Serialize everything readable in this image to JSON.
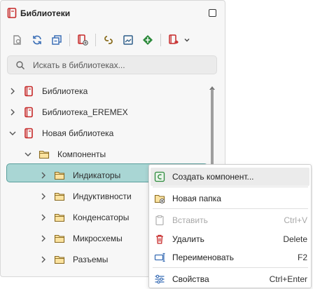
{
  "panel": {
    "title": "Библиотеки",
    "icons": {
      "app": "library-book-icon",
      "maximize": "maximize-icon"
    }
  },
  "toolbar": {
    "buttons": [
      {
        "name": "open-file-icon"
      },
      {
        "name": "refresh-icon"
      },
      {
        "name": "collapse-all-icon"
      },
      {
        "name": "add-library-icon"
      },
      {
        "name": "link-icon"
      },
      {
        "name": "image-icon"
      },
      {
        "name": "component-icon"
      },
      {
        "name": "export-icon"
      },
      {
        "name": "chevron-down-icon"
      }
    ]
  },
  "search": {
    "placeholder": "Искать в библиотеках..."
  },
  "tree": {
    "items": [
      {
        "label": "Библиотека",
        "level": 0,
        "expanded": false,
        "type": "library"
      },
      {
        "label": "Библиотека_EREMEX",
        "level": 0,
        "expanded": false,
        "type": "library"
      },
      {
        "label": "Новая библиотека",
        "level": 0,
        "expanded": true,
        "type": "library"
      },
      {
        "label": "Компоненты",
        "level": 1,
        "expanded": true,
        "type": "folder"
      },
      {
        "label": "Индикаторы",
        "level": 2,
        "expanded": false,
        "type": "folder",
        "selected": true
      },
      {
        "label": "Индуктивности",
        "level": 2,
        "expanded": false,
        "type": "folder"
      },
      {
        "label": "Конденсаторы",
        "level": 2,
        "expanded": false,
        "type": "folder"
      },
      {
        "label": "Микросхемы",
        "level": 2,
        "expanded": false,
        "type": "folder"
      },
      {
        "label": "Разъемы",
        "level": 2,
        "expanded": false,
        "type": "folder"
      }
    ]
  },
  "context_menu": {
    "items": [
      {
        "label": "Создать компонент...",
        "shortcut": "",
        "icon": "create-component-icon",
        "disabled": false,
        "hover": true
      },
      {
        "label": "Новая папка",
        "shortcut": "",
        "icon": "new-folder-icon",
        "disabled": false
      },
      {
        "label": "Вставить",
        "shortcut": "Ctrl+V",
        "icon": "paste-icon",
        "disabled": true
      },
      {
        "label": "Удалить",
        "shortcut": "Delete",
        "icon": "trash-icon",
        "disabled": false
      },
      {
        "label": "Переименовать",
        "shortcut": "F2",
        "icon": "rename-icon",
        "disabled": false
      },
      {
        "label": "Свойства",
        "shortcut": "Ctrl+Enter",
        "icon": "properties-icon",
        "disabled": false
      }
    ]
  },
  "colors": {
    "selection_bg": "#a9d6d4",
    "selection_border": "#5a9f9c",
    "library_red": "#c62828",
    "folder_yellow": "#f3d37a"
  }
}
